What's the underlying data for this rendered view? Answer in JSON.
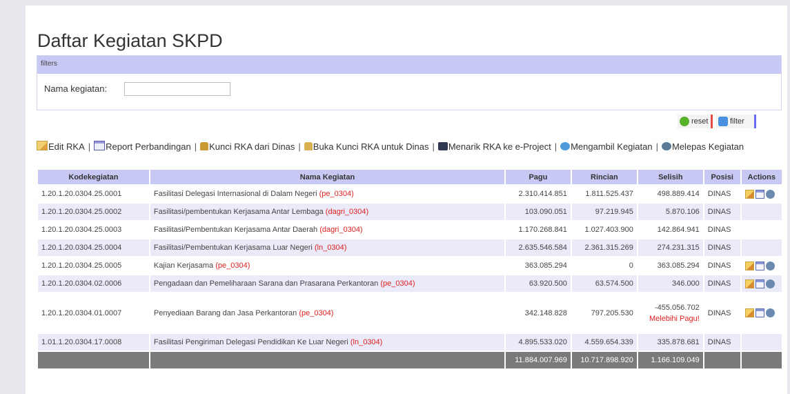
{
  "page": {
    "title": "Daftar Kegiatan SKPD"
  },
  "filters": {
    "header": "filters",
    "name_label": "Nama kegiatan:",
    "name_value": "",
    "reset_label": "reset",
    "filter_label": "filter"
  },
  "actions": {
    "edit_rka": "Edit RKA",
    "report": "Report Perbandingan",
    "lock": "Kunci RKA dari Dinas",
    "unlock": "Buka Kunci RKA untuk Dinas",
    "pull": "Menarik RKA ke e-Project",
    "take": "Mengambil Kegiatan",
    "release": "Melepas Kegiatan",
    "separator": "|"
  },
  "table": {
    "headers": [
      "Kodekegiatan",
      "Nama Kegiatan",
      "Pagu",
      "Rincian",
      "Selisih",
      "Posisi",
      "Actions"
    ],
    "rows": [
      {
        "code": "1.20.1.20.0304.25.0001",
        "name": "Fasilitasi Delegasi Internasional di Dalam Negeri",
        "tag": "(pe_0304)",
        "pagu": "2.310.414.851",
        "rincian": "1.811.525.437",
        "selisih": "498.889.414",
        "warning": "",
        "posisi": "DINAS",
        "has_actions": true
      },
      {
        "code": "1.20.1.20.0304.25.0002",
        "name": "Fasilitasi/pembentukan Kerjasama Antar Lembaga",
        "tag": "(dagri_0304)",
        "pagu": "103.090.051",
        "rincian": "97.219.945",
        "selisih": "5.870.106",
        "warning": "",
        "posisi": "DINAS",
        "has_actions": false
      },
      {
        "code": "1.20.1.20.0304.25.0003",
        "name": "Fasilitasi/Pembentukan Kerjasama Antar Daerah",
        "tag": "(dagri_0304)",
        "pagu": "1.170.268.841",
        "rincian": "1.027.403.900",
        "selisih": "142.864.941",
        "warning": "",
        "posisi": "DINAS",
        "has_actions": false
      },
      {
        "code": "1.20.1.20.0304.25.0004",
        "name": "Fasilitasi/Pembentukan Kerjasama Luar Negeri",
        "tag": "(ln_0304)",
        "pagu": "2.635.546.584",
        "rincian": "2.361.315.269",
        "selisih": "274.231.315",
        "warning": "",
        "posisi": "DINAS",
        "has_actions": false
      },
      {
        "code": "1.20.1.20.0304.25.0005",
        "name": "Kajian Kerjasama",
        "tag": "(pe_0304)",
        "pagu": "363.085.294",
        "rincian": "0",
        "selisih": "363.085.294",
        "warning": "",
        "posisi": "DINAS",
        "has_actions": true
      },
      {
        "code": "1.20.1.20.0304.02.0006",
        "name": "Pengadaan dan Pemeliharaan Sarana dan Prasarana Perkantoran",
        "tag": "(pe_0304)",
        "pagu": "63.920.500",
        "rincian": "63.574.500",
        "selisih": "346.000",
        "warning": "",
        "posisi": "DINAS",
        "has_actions": true
      },
      {
        "code": "1.20.1.20.0304.01.0007",
        "name": "Penyediaan Barang dan Jasa Perkantoran",
        "tag": "(pe_0304)",
        "pagu": "342.148.828",
        "rincian": "797.205.530",
        "selisih": "-455.056.702",
        "warning": "Melebihi Pagu!",
        "posisi": "DINAS",
        "has_actions": true
      },
      {
        "code": "1.01.1.20.0304.17.0008",
        "name": "Fasilitasi Pengiriman Delegasi Pendidikan Ke Luar Negeri",
        "tag": "(ln_0304)",
        "pagu": "4.895.533.020",
        "rincian": "4.559.654.339",
        "selisih": "335.878.681",
        "warning": "",
        "posisi": "DINAS",
        "has_actions": false
      }
    ],
    "totals": {
      "pagu": "11.884.007.969",
      "rincian": "10.717.898.920",
      "selisih": "1.166.109.049"
    }
  }
}
